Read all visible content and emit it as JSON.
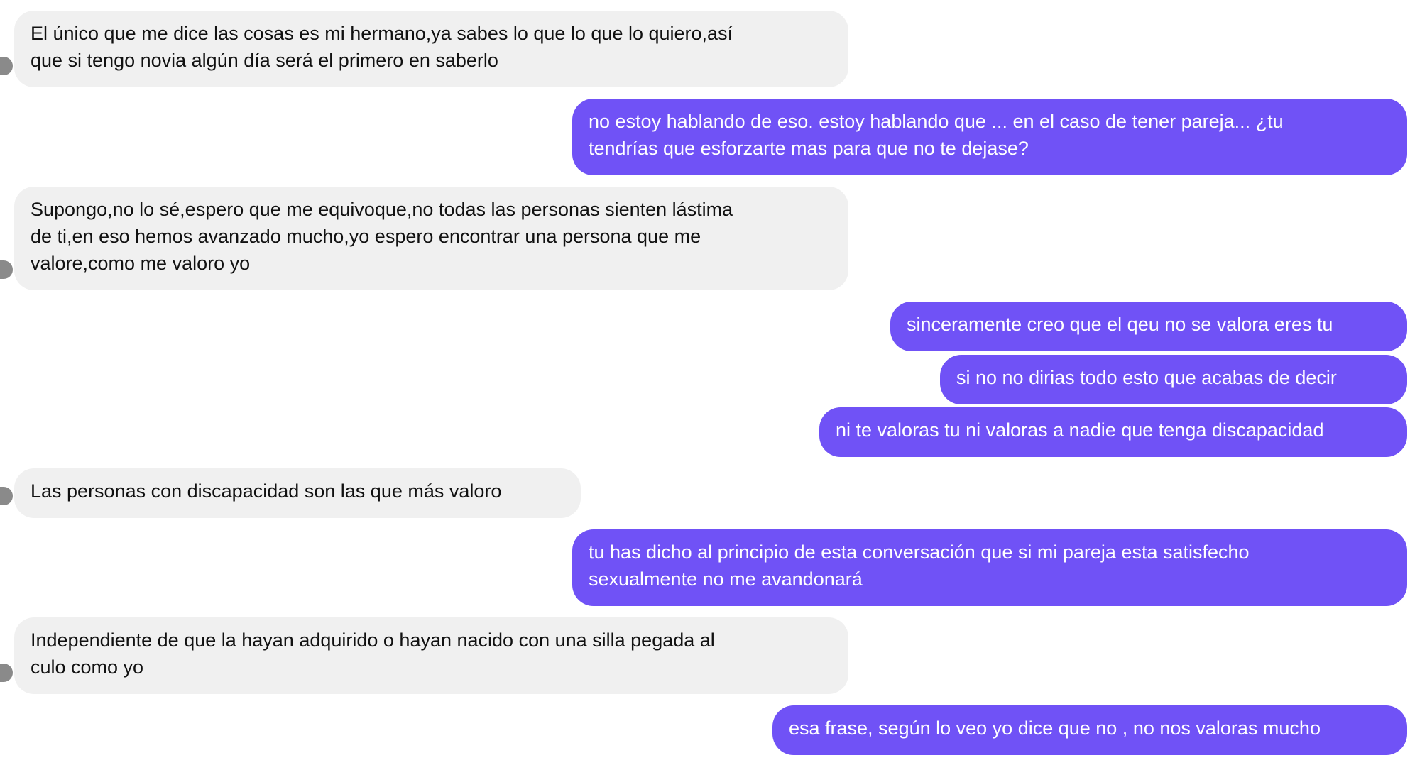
{
  "conversation": {
    "messages": [
      {
        "sender": "other",
        "text": "El único que me dice las cosas es mi hermano,ya sabes lo que lo que lo quiero,así\nque si tengo novia algún día será el primero en saberlo"
      },
      {
        "sender": "me",
        "text": "no estoy hablando de eso. estoy hablando que ... en el caso de tener pareja... ¿tu\ntendrías que esforzarte mas para que no te dejase?"
      },
      {
        "sender": "other",
        "text": "Supongo,no lo sé,espero que me equivoque,no todas las personas sienten lástima\nde ti,en eso hemos avanzado mucho,yo espero encontrar una persona que me\nvalore,como me valoro yo"
      },
      {
        "sender": "me",
        "text": "sinceramente creo que el qeu no se valora eres tu"
      },
      {
        "sender": "me",
        "text": "si no no dirias todo esto que acabas de decir"
      },
      {
        "sender": "me",
        "text": "ni te valoras tu ni valoras a nadie que tenga discapacidad"
      },
      {
        "sender": "other",
        "text": "Las personas con discapacidad son las que más valoro"
      },
      {
        "sender": "me",
        "text": "tu has dicho al principio de esta conversación que si mi pareja esta satisfecho\nsexualmente no me avandonará"
      },
      {
        "sender": "other",
        "text": "Independiente de que la hayan adquirido o hayan nacido con una silla pegada al\nculo como yo"
      },
      {
        "sender": "me",
        "text": "esa frase, según lo veo yo dice que no , no nos valoras mucho"
      }
    ]
  },
  "colors": {
    "outgoing_bubble": "#7052f6",
    "incoming_bubble": "#f0f0f0",
    "outgoing_text": "#ffffff",
    "incoming_text": "#111111"
  }
}
